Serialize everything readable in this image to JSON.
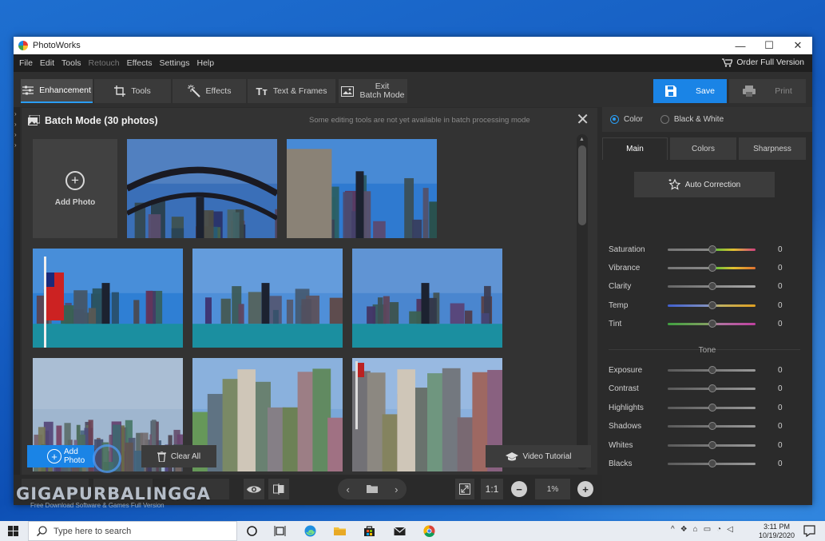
{
  "window": {
    "title": "PhotoWorks",
    "controls": {
      "minimize": "—",
      "maximize": "☐",
      "close": "✕"
    }
  },
  "menu": {
    "items": [
      {
        "label": "File",
        "enabled": true
      },
      {
        "label": "Edit",
        "enabled": true
      },
      {
        "label": "Tools",
        "enabled": true
      },
      {
        "label": "Retouch",
        "enabled": false
      },
      {
        "label": "Effects",
        "enabled": true
      },
      {
        "label": "Settings",
        "enabled": true
      },
      {
        "label": "Help",
        "enabled": true
      }
    ],
    "order_label": "Order Full Version"
  },
  "toolbar": {
    "enhancement": "Enhancement",
    "tools": "Tools",
    "effects": "Effects",
    "text_frames": "Text & Frames",
    "exit_line1": "Exit",
    "exit_line2": "Batch Mode",
    "save": "Save",
    "print": "Print"
  },
  "batch": {
    "title": "Batch Mode (30 photos)",
    "note": "Some editing tools are not yet available in batch processing mode",
    "close": "✕",
    "add_tile_label": "Add Photo",
    "photos": [
      {
        "scene": "bridge-skyline",
        "sky": "#3a6fb8"
      },
      {
        "scene": "skyline-tower",
        "sky": "#2f7ad0"
      },
      {
        "scene": "flag-lake",
        "sky": "#2f7fd4"
      },
      {
        "scene": "skyline-lake",
        "sky": "#4f8fd8"
      },
      {
        "scene": "skyline-lake",
        "sky": "#4a86cf"
      },
      {
        "scene": "aerial-city",
        "sky": "#9fb6cf"
      },
      {
        "scene": "tower-close",
        "sky": "#7aa7d9"
      },
      {
        "scene": "tower-flag",
        "sky": "#8ab0dd"
      }
    ]
  },
  "actions": {
    "add_photo": "Add Photo",
    "clear_all": "Clear All",
    "video_tutorial": "Video Tutorial"
  },
  "bottombar": {
    "ratio": "1:1",
    "zoom": "1%"
  },
  "panel": {
    "mode_color": "Color",
    "mode_bw": "Black & White",
    "tabs": [
      "Main",
      "Colors",
      "Sharpness"
    ],
    "auto_correction": "Auto Correction",
    "sliders": [
      {
        "label": "Saturation",
        "value": "0",
        "track": "linear-gradient(90deg,#777,#888 45%,#6bbf3a 55%,#e0c030 75%,#d04080)"
      },
      {
        "label": "Vibrance",
        "value": "0",
        "track": "linear-gradient(90deg,#777,#888 45%,#6bbf3a 55%,#e0c030 75%,#e07030)"
      },
      {
        "label": "Clarity",
        "value": "0",
        "track": "linear-gradient(90deg,#666,#aaa)"
      },
      {
        "label": "Temp",
        "value": "0",
        "track": "linear-gradient(90deg,#4060d0,#8090c0 45%,#c0b060 60%,#e0a020)"
      },
      {
        "label": "Tint",
        "value": "0",
        "track": "linear-gradient(90deg,#40a040,#80a060 45%,#b070a0 60%,#c040a0)"
      }
    ],
    "tone_label": "Tone",
    "tone_sliders": [
      {
        "label": "Exposure",
        "value": "0"
      },
      {
        "label": "Contrast",
        "value": "0"
      },
      {
        "label": "Highlights",
        "value": "0"
      },
      {
        "label": "Shadows",
        "value": "0"
      },
      {
        "label": "Whites",
        "value": "0"
      },
      {
        "label": "Blacks",
        "value": "0"
      }
    ]
  },
  "watermark": {
    "brand": "GIGAPURBALINGGA",
    "sub": "Free Download Software & Games Full Version"
  },
  "taskbar": {
    "search_placeholder": "Type here to search",
    "time": "3:11 PM",
    "date": "10/19/2020"
  }
}
